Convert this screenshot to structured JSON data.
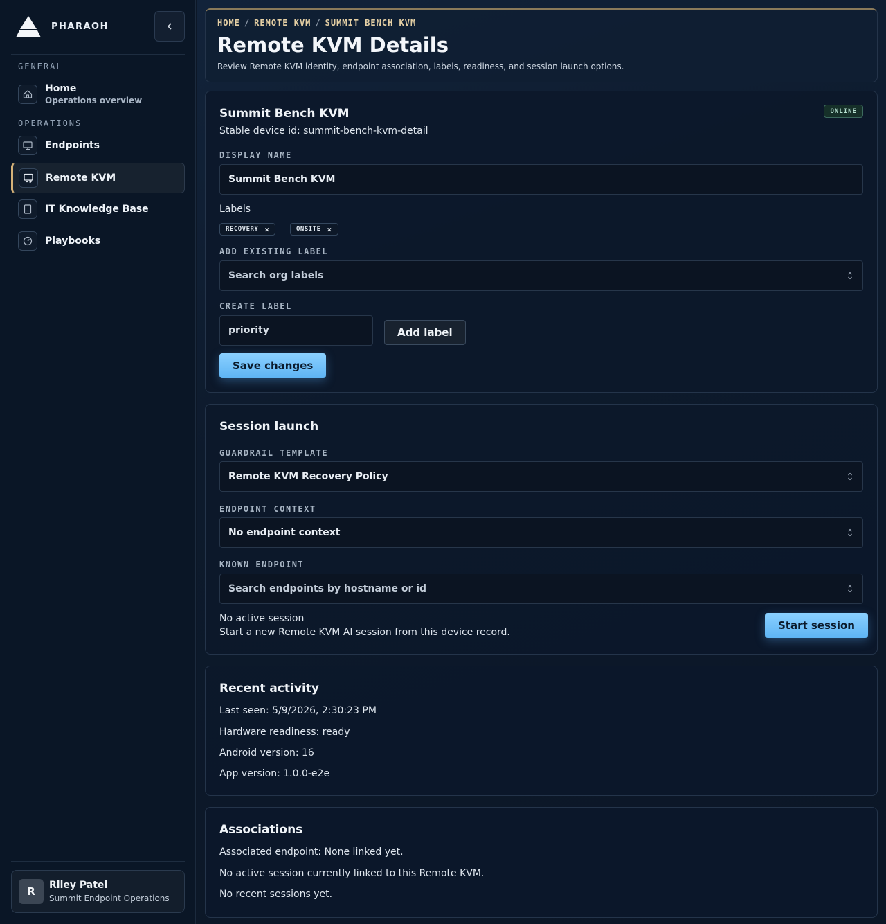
{
  "brand": {
    "name": "PHARAOH"
  },
  "sidebar": {
    "sections": {
      "general": "GENERAL",
      "operations": "OPERATIONS"
    },
    "items": [
      {
        "label": "Home",
        "sub": "Operations overview",
        "icon": "home-icon"
      },
      {
        "label": "Endpoints",
        "icon": "monitor-icon"
      },
      {
        "label": "Remote KVM",
        "icon": "remote-screen-icon",
        "active": true
      },
      {
        "label": "IT Knowledge Base",
        "icon": "book-icon"
      },
      {
        "label": "Playbooks",
        "icon": "gauge-icon"
      }
    ],
    "user": {
      "initial": "R",
      "name": "Riley Patel",
      "org": "Summit Endpoint Operations"
    }
  },
  "header": {
    "breadcrumb": [
      "HOME",
      "REMOTE KVM",
      "SUMMIT BENCH KVM"
    ],
    "separator": "/",
    "title": "Remote KVM Details",
    "subtitle": "Review Remote KVM identity, endpoint association, labels, readiness, and session launch options."
  },
  "device": {
    "name": "Summit Bench KVM",
    "stable_id": "Stable device id: summit-bench-kvm-detail",
    "status": "ONLINE",
    "display_name_label": "DISPLAY NAME",
    "display_name_value": "Summit Bench KVM",
    "labels_heading": "Labels",
    "labels": [
      "RECOVERY",
      "ONSITE"
    ],
    "chip_remove": "×",
    "add_label_heading": "ADD EXISTING LABEL",
    "add_label_placeholder": "Search org labels",
    "create_label_heading": "CREATE LABEL",
    "create_label_value": "priority",
    "add_label_button": "Add label",
    "save_button": "Save changes"
  },
  "session": {
    "title": "Session launch",
    "guardrail_label": "GUARDRAIL TEMPLATE",
    "guardrail_value": "Remote KVM Recovery Policy",
    "endpoint_context_label": "ENDPOINT CONTEXT",
    "endpoint_context_value": "No endpoint context",
    "known_endpoint_label": "KNOWN ENDPOINT",
    "known_endpoint_placeholder": "Search endpoints by hostname or id",
    "status_title": "No active session",
    "status_desc": "Start a new Remote KVM AI session from this device record.",
    "start_button": "Start session"
  },
  "activity": {
    "title": "Recent activity",
    "last_seen": "Last seen: 5/9/2026, 2:30:23 PM",
    "hardware": "Hardware readiness: ready",
    "android": "Android version: 16",
    "app": "App version: 1.0.0-e2e"
  },
  "associations": {
    "title": "Associations",
    "endpoint": "Associated endpoint: None linked yet.",
    "active_session": "No active session currently linked to this Remote KVM.",
    "recent_sessions": "No recent sessions yet."
  }
}
